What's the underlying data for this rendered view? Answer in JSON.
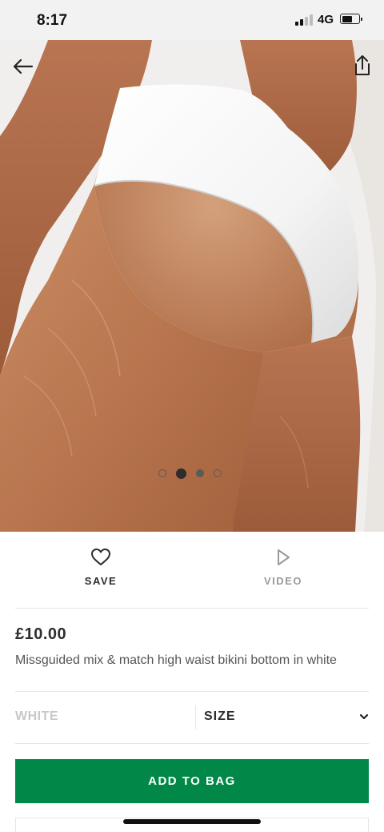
{
  "status_bar": {
    "time": "8:17",
    "network": "4G",
    "battery_level": 0.55,
    "signal_bars_filled": 2,
    "signal_bars_total": 4
  },
  "gallery": {
    "image_count": 4,
    "active_index": 1,
    "icons": {
      "back": "arrow-left-icon",
      "share": "share-icon"
    }
  },
  "actions": {
    "save_label": "SAVE",
    "save_icon": "heart-icon",
    "video_label": "VIDEO",
    "video_icon": "play-icon"
  },
  "product": {
    "price": "£10.00",
    "title": "Missguided mix & match high waist bikini bottom in white"
  },
  "options": {
    "colour_value": "WHITE",
    "size_label": "SIZE",
    "size_icon": "chevron-down-icon"
  },
  "cta": {
    "add_to_bag_label": "ADD TO BAG"
  },
  "colors": {
    "accent_green": "#018849",
    "text_dark": "#2d2d2d",
    "text_muted": "#9a9a9a",
    "divider": "#e6e6e6"
  }
}
